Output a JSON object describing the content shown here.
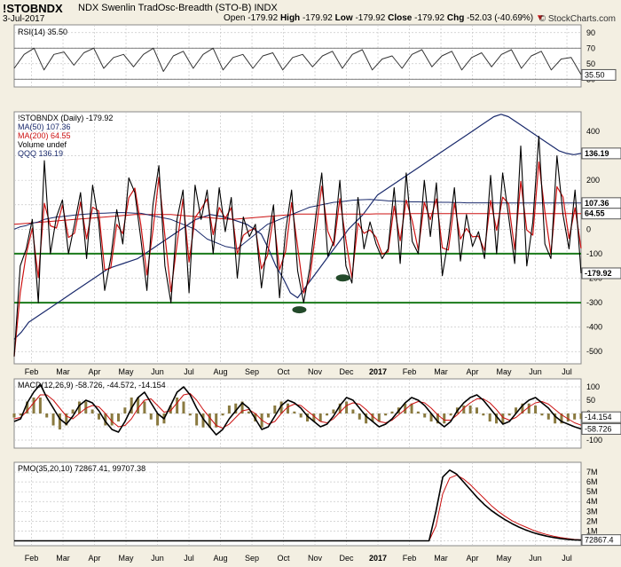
{
  "header": {
    "symbol": "!STOBNDX",
    "description": "NDX Swenlin TradOsc-Breadth (STO-B)  INDX",
    "date": "3-Jul-2017",
    "open_label": "Open",
    "open": "-179.92",
    "high_label": "High",
    "high": "-179.92",
    "low_label": "Low",
    "low": "-179.92",
    "close_label": "Close",
    "close": "-179.92",
    "chg_label": "Chg",
    "chg": "-52.03 (-40.69%)",
    "watermark": "© StockCharts.com"
  },
  "colors": {
    "black": "#000000",
    "navy": "#1a2a6c",
    "red": "#cc1111",
    "green": "#1a7a1a",
    "grid": "#c8c8c8",
    "panel": "#ffffff",
    "olive": "#8a7a40"
  },
  "chart_data": [
    {
      "type": "line",
      "panel": "RSI",
      "legend": "RSI(14) 35.50",
      "ylim": [
        20,
        100
      ],
      "yticks": [
        "90",
        "70",
        "50",
        "30"
      ],
      "hlines": [
        70,
        30
      ],
      "last_label": "35.50",
      "series": [
        {
          "name": "RSI(14)",
          "values": [
            44,
            62,
            70,
            42,
            62,
            65,
            48,
            64,
            70,
            44,
            58,
            62,
            46,
            62,
            70,
            40,
            60,
            66,
            44,
            62,
            70,
            42,
            58,
            62,
            44,
            60,
            64,
            42,
            58,
            62,
            46,
            60,
            66,
            44,
            62,
            68,
            42,
            56,
            60,
            44,
            62,
            68,
            46,
            60,
            66,
            42,
            58,
            64,
            46,
            62,
            68,
            44,
            60,
            66,
            42,
            56,
            58,
            36
          ]
        }
      ]
    },
    {
      "type": "line",
      "panel": "main",
      "legend": [
        {
          "label": "!STOBNDX (Daily) -179.92",
          "color": "#000000"
        },
        {
          "label": "MA(50) 107.36",
          "color": "#1a2a6c"
        },
        {
          "label": "MA(200) 64.55",
          "color": "#cc1111"
        },
        {
          "label": "Volume undef",
          "color": "#000000"
        },
        {
          "label": "QQQ 136.19",
          "color": "#1a2a6c"
        }
      ],
      "ylim": [
        -550,
        480
      ],
      "yticks": [
        "400",
        "300",
        "200",
        "100",
        "0",
        "-100",
        "-200",
        "-300",
        "-400",
        "-500"
      ],
      "hlines": [
        -100,
        -300
      ],
      "ellipses": [
        {
          "x": 0.503,
          "y": -300
        },
        {
          "x": 0.58,
          "y": -170
        }
      ],
      "last_labels": [
        {
          "text": "136.19",
          "value": 310,
          "bg": "#ffffff"
        },
        {
          "text": "107.36",
          "value": 107,
          "bg": "#ffffff"
        },
        {
          "text": "64.55",
          "value": 64,
          "bg": "#ffffff"
        },
        {
          "text": "-179.92",
          "value": -180,
          "bg": "#ffffff"
        }
      ],
      "series": [
        {
          "name": "!STOBNDX",
          "values": [
            -520,
            -150,
            -80,
            40,
            -300,
            280,
            -100,
            50,
            120,
            -100,
            20,
            150,
            -120,
            180,
            30,
            -250,
            -120,
            80,
            -60,
            210,
            150,
            -40,
            -250,
            100,
            260,
            -150,
            -300,
            40,
            160,
            -260,
            180,
            40,
            160,
            -100,
            170,
            -10,
            130,
            -200,
            50,
            -30,
            20,
            -240,
            -50,
            100,
            -280,
            -10,
            160,
            -170,
            -300,
            -160,
            50,
            230,
            -110,
            -50,
            200,
            -150,
            -220,
            130,
            -80,
            30,
            -60,
            -120,
            -80,
            170,
            -140,
            230,
            -50,
            -100,
            200,
            -30,
            190,
            -190,
            -40,
            170,
            -130,
            60,
            -70,
            -10,
            -120,
            220,
            -100,
            230,
            50,
            -140,
            340,
            -150,
            30,
            380,
            -60,
            -120,
            300,
            60,
            -80,
            160,
            -180
          ]
        },
        {
          "name": "MA(50)",
          "values": [
            0,
            10,
            15,
            25,
            30,
            40,
            45,
            50,
            52,
            55,
            58,
            60,
            62,
            64,
            65,
            66,
            67,
            68,
            68,
            67,
            66,
            65,
            60,
            55,
            50,
            45,
            40,
            30,
            20,
            10,
            0,
            -20,
            -40,
            -50,
            -60,
            -70,
            -75,
            -80,
            -60,
            -40,
            -20,
            0,
            20,
            30,
            40,
            50,
            60,
            70,
            80,
            90,
            95,
            100,
            105,
            110,
            112,
            115,
            118,
            120,
            121,
            122,
            120,
            118,
            116,
            115,
            114,
            113,
            112,
            112,
            111,
            111,
            110,
            110,
            110,
            109,
            109,
            108,
            108,
            108,
            108,
            108,
            107,
            107,
            107,
            107,
            107,
            107,
            107,
            107,
            107,
            107,
            107,
            107,
            107,
            107,
            107
          ]
        },
        {
          "name": "MA(200)",
          "values": [
            20,
            22,
            24,
            26,
            28,
            30,
            32,
            34,
            36,
            38,
            40,
            42,
            44,
            46,
            48,
            50,
            52,
            54,
            56,
            58,
            60,
            60,
            60,
            60,
            60,
            60,
            60,
            58,
            56,
            54,
            52,
            50,
            48,
            46,
            44,
            42,
            40,
            42,
            44,
            46,
            48,
            50,
            52,
            54,
            56,
            58,
            60,
            62,
            62,
            62,
            62,
            62,
            62,
            62,
            62,
            62,
            62,
            62,
            62,
            62,
            63,
            63,
            63,
            63,
            63,
            63,
            64,
            64,
            64,
            64,
            64,
            64,
            64,
            64,
            64,
            64,
            64,
            64,
            64,
            64,
            64,
            64,
            64,
            64,
            64,
            64,
            64,
            64,
            64,
            64,
            64,
            64,
            64,
            64,
            64
          ]
        },
        {
          "name": "QQQ",
          "values": [
            -450,
            -420,
            -380,
            -360,
            -340,
            -320,
            -300,
            -280,
            -260,
            -240,
            -220,
            -200,
            -180,
            -160,
            -150,
            -140,
            -130,
            -120,
            -100,
            -80,
            -60,
            -40,
            -20,
            0,
            20,
            40,
            50,
            60,
            55,
            50,
            40,
            30,
            20,
            0,
            -20,
            -80,
            -150,
            -200,
            -260,
            -280,
            -240,
            -200,
            -160,
            -120,
            -80,
            -40,
            0,
            30,
            60,
            100,
            140,
            160,
            180,
            200,
            220,
            240,
            260,
            280,
            300,
            320,
            340,
            360,
            380,
            400,
            420,
            440,
            460,
            470,
            460,
            440,
            420,
            400,
            380,
            360,
            340,
            320,
            310,
            305,
            310
          ]
        }
      ]
    },
    {
      "type": "line",
      "panel": "MACD",
      "legend": "MACD(12,26,9) -58.726, -44.572, -14.154",
      "ylim": [
        -130,
        130
      ],
      "yticks": [
        "100",
        "50",
        "0",
        "-50",
        "-100"
      ],
      "last_labels": [
        {
          "text": "-14.154",
          "value": -14
        },
        {
          "text": "-58.726",
          "value": -58
        }
      ],
      "series": [
        {
          "name": "MACD",
          "values": [
            -30,
            -20,
            40,
            80,
            110,
            60,
            20,
            -20,
            -40,
            -10,
            30,
            50,
            40,
            10,
            -30,
            -60,
            -70,
            -30,
            20,
            60,
            80,
            40,
            0,
            -20,
            30,
            80,
            100,
            70,
            20,
            -20,
            -50,
            -80,
            -60,
            -20,
            10,
            40,
            20,
            -20,
            -60,
            -50,
            -10,
            30,
            50,
            40,
            20,
            -10,
            -30,
            -50,
            -40,
            -10,
            30,
            60,
            50,
            20,
            -10,
            -30,
            -50,
            -40,
            -20,
            10,
            40,
            60,
            50,
            30,
            0,
            -30,
            -50,
            -30,
            10,
            40,
            60,
            70,
            50,
            20,
            -10,
            -40,
            -30,
            0,
            30,
            50,
            60,
            40,
            20,
            -10,
            -30,
            -40,
            -50,
            -58
          ]
        },
        {
          "name": "Signal",
          "values": [
            -20,
            -15,
            10,
            40,
            70,
            70,
            50,
            20,
            -10,
            -20,
            0,
            20,
            30,
            25,
            0,
            -30,
            -50,
            -45,
            -20,
            20,
            50,
            55,
            30,
            5,
            10,
            40,
            70,
            75,
            50,
            15,
            -15,
            -45,
            -55,
            -40,
            -15,
            10,
            15,
            0,
            -25,
            -40,
            -30,
            0,
            25,
            35,
            30,
            10,
            -10,
            -30,
            -35,
            -20,
            5,
            30,
            40,
            35,
            15,
            -10,
            -30,
            -35,
            -25,
            -5,
            15,
            35,
            45,
            40,
            20,
            -5,
            -25,
            -25,
            -5,
            20,
            40,
            55,
            55,
            40,
            15,
            -15,
            -25,
            -15,
            5,
            25,
            40,
            45,
            35,
            15,
            -5,
            -20,
            -35,
            -44
          ]
        }
      ]
    },
    {
      "type": "line",
      "panel": "PMO",
      "legend": "PMO(35,20,10) 72867.41, 99707.38",
      "ylim": [
        -500000,
        8000000
      ],
      "yticks": [
        "7M",
        "6M",
        "5M",
        "4M",
        "3M",
        "2M",
        "1M",
        "0"
      ],
      "last_label": "72867.4",
      "series": [
        {
          "name": "PMO",
          "values": [
            0,
            0,
            0,
            0,
            0,
            0,
            0,
            0,
            0,
            0,
            0,
            0,
            0,
            0,
            0,
            0,
            0,
            0,
            0,
            0,
            0,
            0,
            0,
            0,
            0,
            0,
            0,
            0,
            0,
            0,
            0,
            0,
            0,
            0,
            0,
            0,
            0,
            0,
            0,
            0,
            0,
            0,
            0,
            0,
            0,
            0,
            0,
            0,
            0,
            0,
            0,
            0,
            0,
            0,
            0,
            0,
            0,
            0,
            0,
            0,
            0,
            3000000,
            6500000,
            7200000,
            6800000,
            6000000,
            5200000,
            4400000,
            3700000,
            3100000,
            2600000,
            2150000,
            1750000,
            1400000,
            1100000,
            850000,
            650000,
            480000,
            340000,
            230000,
            150000,
            100000,
            72867
          ]
        },
        {
          "name": "Signal",
          "values": [
            0,
            0,
            0,
            0,
            0,
            0,
            0,
            0,
            0,
            0,
            0,
            0,
            0,
            0,
            0,
            0,
            0,
            0,
            0,
            0,
            0,
            0,
            0,
            0,
            0,
            0,
            0,
            0,
            0,
            0,
            0,
            0,
            0,
            0,
            0,
            0,
            0,
            0,
            0,
            0,
            0,
            0,
            0,
            0,
            0,
            0,
            0,
            0,
            0,
            0,
            0,
            0,
            0,
            0,
            0,
            0,
            0,
            0,
            0,
            0,
            0,
            1500000,
            4800000,
            6400000,
            6700000,
            6300000,
            5700000,
            5000000,
            4300000,
            3600000,
            3000000,
            2500000,
            2050000,
            1700000,
            1400000,
            1100000,
            850000,
            650000,
            480000,
            340000,
            230000,
            140000,
            99707
          ]
        }
      ]
    }
  ],
  "xaxis": {
    "months": [
      "Feb",
      "Mar",
      "Apr",
      "May",
      "Jun",
      "Jul",
      "Aug",
      "Sep",
      "Oct",
      "Nov",
      "Dec",
      "2017",
      "Feb",
      "Mar",
      "Apr",
      "May",
      "Jun",
      "Jul"
    ]
  }
}
